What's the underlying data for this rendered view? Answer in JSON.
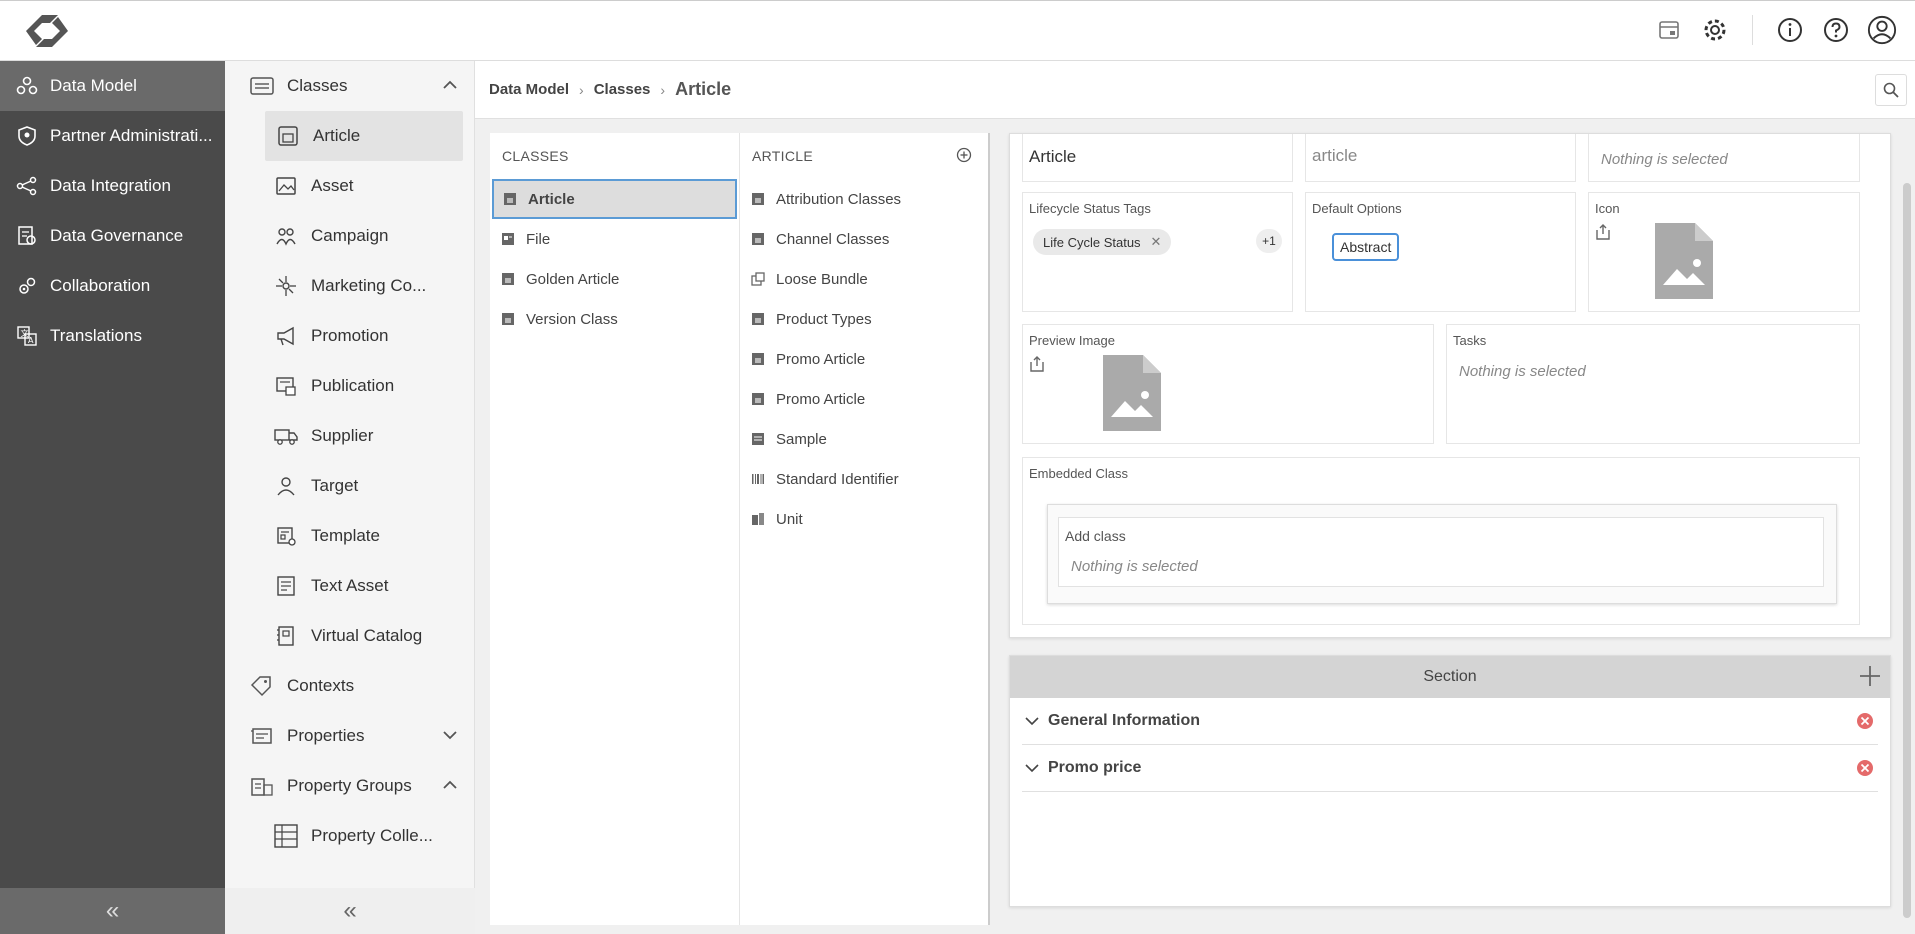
{
  "colors": {
    "dark_nav": "#4a4a4a",
    "accent_blue": "#4a90d9",
    "delete_red": "#e46a6a"
  },
  "topbar": {
    "icons": [
      "archive-icon",
      "gear-icon",
      "info-icon",
      "help-icon",
      "user-icon"
    ]
  },
  "leftnav": {
    "items": [
      {
        "label": "Data Model",
        "icon": "data-model-icon"
      },
      {
        "label": "Partner Administrati...",
        "icon": "shield-icon"
      },
      {
        "label": "Data Integration",
        "icon": "integration-icon"
      },
      {
        "label": "Data Governance",
        "icon": "governance-icon"
      },
      {
        "label": "Collaboration",
        "icon": "collaboration-icon"
      },
      {
        "label": "Translations",
        "icon": "translations-icon"
      }
    ],
    "collapse_label": "«"
  },
  "subnav": {
    "classes_label": "Classes",
    "class_items": [
      "Article",
      "Asset",
      "Campaign",
      "Marketing Co...",
      "Promotion",
      "Publication",
      "Supplier",
      "Target",
      "Template",
      "Text Asset",
      "Virtual Catalog"
    ],
    "contexts_label": "Contexts",
    "properties_label": "Properties",
    "property_groups_label": "Property Groups",
    "property_collections_label": "Property Colle...",
    "collapse_label": "«"
  },
  "breadcrumb": {
    "items": [
      "Data Model",
      "Classes"
    ],
    "current": "Article",
    "sep": "›"
  },
  "classes_panel": {
    "title": "CLASSES",
    "items": [
      "Article",
      "File",
      "Golden Article",
      "Version Class"
    ]
  },
  "article_panel": {
    "title": "ARTICLE",
    "items": [
      "Attribution Classes",
      "Channel Classes",
      "Loose Bundle",
      "Product Types",
      "Promo Article",
      "Promo Article",
      "Sample",
      "Standard Identifier",
      "Unit"
    ]
  },
  "details": {
    "name_value": "Article",
    "key_value": "article",
    "top_right_placeholder": "Nothing is selected",
    "lifecycle_label": "Lifecycle Status Tags",
    "lifecycle_chip": "Life Cycle Status",
    "lifecycle_more": "+1",
    "default_options_label": "Default Options",
    "abstract_label": "Abstract",
    "icon_label": "Icon",
    "preview_label": "Preview Image",
    "tasks_label": "Tasks",
    "tasks_placeholder": "Nothing is selected",
    "embedded_label": "Embedded Class",
    "add_class_label": "Add class",
    "add_class_placeholder": "Nothing is selected"
  },
  "section": {
    "title": "Section",
    "rows": [
      "General Information",
      "Promo price"
    ]
  }
}
